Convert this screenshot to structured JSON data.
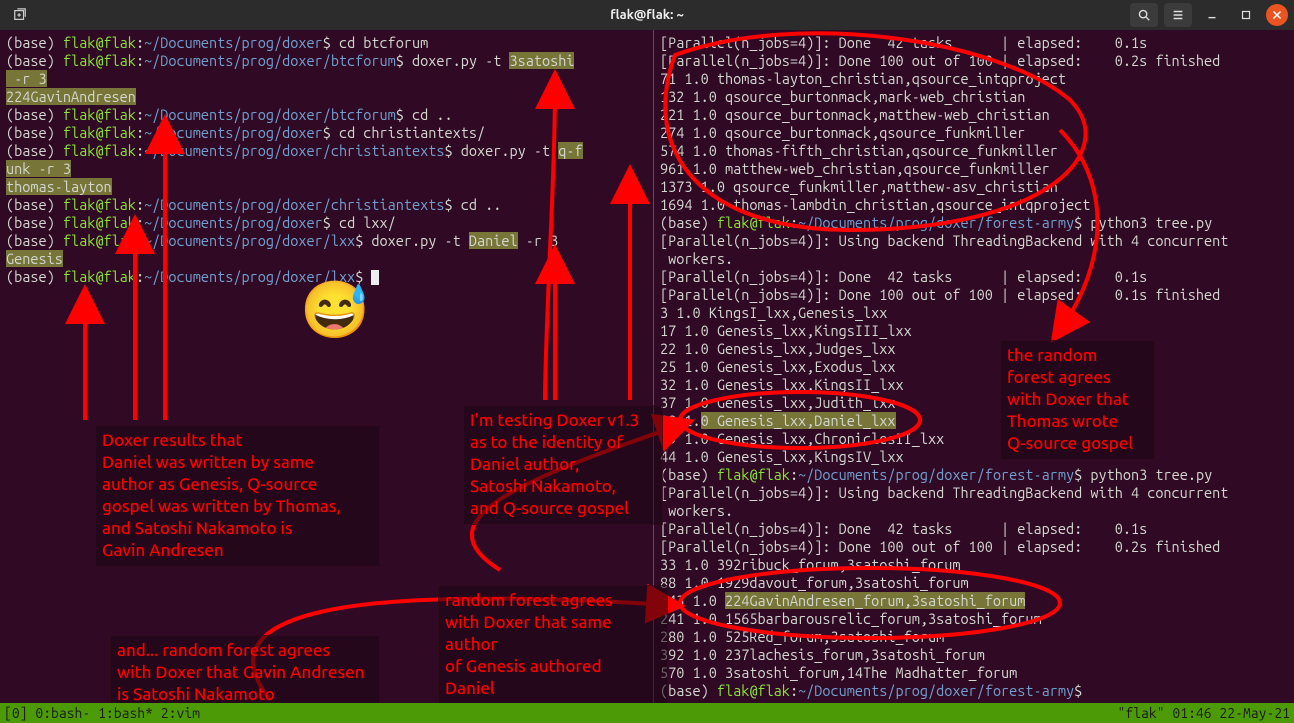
{
  "titlebar": {
    "title": "flak@flak: ~"
  },
  "statusbar": {
    "left": "[0] 0:bash- 1:bash* 2:vim",
    "right": "\"flak\" 01:46 22-May-21"
  },
  "left_lines": [
    {
      "segs": [
        {
          "t": "(base) ",
          "c": "white"
        },
        {
          "t": "flak@flak",
          "c": "green"
        },
        {
          "t": ":",
          "c": "white"
        },
        {
          "t": "~/Documents/prog/doxer",
          "c": "blue"
        },
        {
          "t": "$ cd btcforum",
          "c": "white"
        }
      ]
    },
    {
      "segs": [
        {
          "t": "(base) ",
          "c": "white"
        },
        {
          "t": "flak@flak",
          "c": "green"
        },
        {
          "t": ":",
          "c": "white"
        },
        {
          "t": "~/Documents/prog/doxer/btcforum",
          "c": "blue"
        },
        {
          "t": "$ doxer.py -t ",
          "c": "white"
        },
        {
          "t": "3satoshi",
          "c": "hi"
        }
      ]
    },
    {
      "segs": [
        {
          "t": " -r 3",
          "c": "hi"
        }
      ]
    },
    {
      "segs": [
        {
          "t": "224GavinAndresen",
          "c": "hi"
        }
      ]
    },
    {
      "segs": [
        {
          "t": "(base) ",
          "c": "white"
        },
        {
          "t": "flak@flak",
          "c": "green"
        },
        {
          "t": ":",
          "c": "white"
        },
        {
          "t": "~/Documents/prog/doxer/btcforum",
          "c": "blue"
        },
        {
          "t": "$ cd ..",
          "c": "white"
        }
      ]
    },
    {
      "segs": [
        {
          "t": "(base) ",
          "c": "white"
        },
        {
          "t": "flak@flak",
          "c": "green"
        },
        {
          "t": ":",
          "c": "white"
        },
        {
          "t": "~/Documents/prog/doxer",
          "c": "blue"
        },
        {
          "t": "$ cd christiantexts/",
          "c": "white"
        }
      ]
    },
    {
      "segs": [
        {
          "t": "(base) ",
          "c": "white"
        },
        {
          "t": "flak@flak",
          "c": "green"
        },
        {
          "t": ":",
          "c": "white"
        },
        {
          "t": "~/Documents/prog/doxer/christiantexts",
          "c": "blue"
        },
        {
          "t": "$ doxer.py -t ",
          "c": "white"
        },
        {
          "t": "q-f",
          "c": "hi"
        }
      ]
    },
    {
      "segs": [
        {
          "t": "unk -r 3",
          "c": "hi"
        }
      ]
    },
    {
      "segs": [
        {
          "t": "thomas-layton",
          "c": "hi"
        }
      ]
    },
    {
      "segs": [
        {
          "t": "(base) ",
          "c": "white"
        },
        {
          "t": "flak@flak",
          "c": "green"
        },
        {
          "t": ":",
          "c": "white"
        },
        {
          "t": "~/Documents/prog/doxer/christiantexts",
          "c": "blue"
        },
        {
          "t": "$ cd ..",
          "c": "white"
        }
      ]
    },
    {
      "segs": [
        {
          "t": "(base) ",
          "c": "white"
        },
        {
          "t": "flak@flak",
          "c": "green"
        },
        {
          "t": ":",
          "c": "white"
        },
        {
          "t": "~/Documents/prog/doxer",
          "c": "blue"
        },
        {
          "t": "$ cd lxx/",
          "c": "white"
        }
      ]
    },
    {
      "segs": [
        {
          "t": "(base) ",
          "c": "white"
        },
        {
          "t": "flak@flak",
          "c": "green"
        },
        {
          "t": ":",
          "c": "white"
        },
        {
          "t": "~/Documents/prog/doxer/lxx",
          "c": "blue"
        },
        {
          "t": "$ doxer.py -t ",
          "c": "white"
        },
        {
          "t": "Daniel",
          "c": "hi"
        },
        {
          "t": " -r 3",
          "c": "white"
        }
      ]
    },
    {
      "segs": [
        {
          "t": "Genesis",
          "c": "hi"
        }
      ]
    },
    {
      "segs": [
        {
          "t": "(base) ",
          "c": "white"
        },
        {
          "t": "flak@flak",
          "c": "green"
        },
        {
          "t": ":",
          "c": "white"
        },
        {
          "t": "~/Documents/prog/doxer/lxx",
          "c": "blue"
        },
        {
          "t": "$ ",
          "c": "white"
        },
        {
          "t": " ",
          "c": "cursor"
        }
      ]
    }
  ],
  "right_lines": [
    {
      "segs": [
        {
          "t": "[Parallel(n_jobs=4)]: Done  42 tasks      | elapsed:    0.1s",
          "c": "white"
        }
      ]
    },
    {
      "segs": [
        {
          "t": "[Parallel(n_jobs=4)]: Done 100 out of 100 | elapsed:    0.2s finished",
          "c": "white"
        }
      ]
    },
    {
      "segs": [
        {
          "t": "71 1.0 thomas-layton_christian,qsource_intqproject",
          "c": "white"
        }
      ]
    },
    {
      "segs": [
        {
          "t": "132 1.0 qsource_burtonmack,mark-web_christian",
          "c": "white"
        }
      ]
    },
    {
      "segs": [
        {
          "t": "221 1.0 qsource_burtonmack,matthew-web_christian",
          "c": "white"
        }
      ]
    },
    {
      "segs": [
        {
          "t": "274 1.0 qsource_burtonmack,qsource_funkmiller",
          "c": "white"
        }
      ]
    },
    {
      "segs": [
        {
          "t": "574 1.0 thomas-fifth_christian,qsource_funkmiller",
          "c": "white"
        }
      ]
    },
    {
      "segs": [
        {
          "t": "961 1.0 matthew-web_christian,qsource_funkmiller",
          "c": "white"
        }
      ]
    },
    {
      "segs": [
        {
          "t": "1373 1.0 qsource_funkmiller,matthew-asv_christian",
          "c": "white"
        }
      ]
    },
    {
      "segs": [
        {
          "t": "1694 1.0 thomas-lambdin_christian,qsource_intqproject",
          "c": "white"
        }
      ]
    },
    {
      "segs": [
        {
          "t": "(base) ",
          "c": "white"
        },
        {
          "t": "flak@flak",
          "c": "green"
        },
        {
          "t": ":",
          "c": "white"
        },
        {
          "t": "~/Documents/prog/doxer/forest-army",
          "c": "blue"
        },
        {
          "t": "$ python3 tree.py",
          "c": "white"
        }
      ]
    },
    {
      "segs": [
        {
          "t": "[Parallel(n_jobs=4)]: Using backend ThreadingBackend with 4 concurrent",
          "c": "white"
        }
      ]
    },
    {
      "segs": [
        {
          "t": " workers.",
          "c": "white"
        }
      ]
    },
    {
      "segs": [
        {
          "t": "[Parallel(n_jobs=4)]: Done  42 tasks      | elapsed:    0.1s",
          "c": "white"
        }
      ]
    },
    {
      "segs": [
        {
          "t": "[Parallel(n_jobs=4)]: Done 100 out of 100 | elapsed:    0.1s finished",
          "c": "white"
        }
      ]
    },
    {
      "segs": [
        {
          "t": "3 1.0 KingsI_lxx,Genesis_lxx",
          "c": "white"
        }
      ]
    },
    {
      "segs": [
        {
          "t": "17 1.0 Genesis_lxx,KingsIII_lxx",
          "c": "white"
        }
      ]
    },
    {
      "segs": [
        {
          "t": "22 1.0 Genesis_lxx,Judges_lxx",
          "c": "white"
        }
      ]
    },
    {
      "segs": [
        {
          "t": "25 1.0 Genesis_lxx,Exodus_lxx",
          "c": "white"
        }
      ]
    },
    {
      "segs": [
        {
          "t": "32 1.0 Genesis_lxx,KingsII_lxx",
          "c": "white"
        }
      ]
    },
    {
      "segs": [
        {
          "t": "37 1.0 Genesis_lxx,Judith_lxx",
          "c": "white"
        }
      ]
    },
    {
      "segs": [
        {
          "t": "38 1.",
          "c": "white"
        },
        {
          "t": "0 Genesis_lxx,Daniel_lxx",
          "c": "hi"
        }
      ]
    },
    {
      "segs": [
        {
          "t": "39 1.0 Genesis_lxx,ChroniclesII_lxx",
          "c": "white"
        }
      ]
    },
    {
      "segs": [
        {
          "t": "44 1.0 Genesis_lxx,KingsIV_lxx",
          "c": "white"
        }
      ]
    },
    {
      "segs": [
        {
          "t": "(base) ",
          "c": "white"
        },
        {
          "t": "flak@flak",
          "c": "green"
        },
        {
          "t": ":",
          "c": "white"
        },
        {
          "t": "~/Documents/prog/doxer/forest-army",
          "c": "blue"
        },
        {
          "t": "$ python3 tree.py",
          "c": "white"
        }
      ]
    },
    {
      "segs": [
        {
          "t": "[Parallel(n_jobs=4)]: Using backend ThreadingBackend with 4 concurrent",
          "c": "white"
        }
      ]
    },
    {
      "segs": [
        {
          "t": " workers.",
          "c": "white"
        }
      ]
    },
    {
      "segs": [
        {
          "t": "[Parallel(n_jobs=4)]: Done  42 tasks      | elapsed:    0.1s",
          "c": "white"
        }
      ]
    },
    {
      "segs": [
        {
          "t": "[Parallel(n_jobs=4)]: Done 100 out of 100 | elapsed:    0.2s finished",
          "c": "white"
        }
      ]
    },
    {
      "segs": [
        {
          "t": "33 1.0 392ribuck_forum,3satoshi_forum",
          "c": "white"
        }
      ]
    },
    {
      "segs": [
        {
          "t": "88 1.0 1929davout_forum,3satoshi_forum",
          "c": "white"
        }
      ]
    },
    {
      "segs": [
        {
          "t": "143 1.0 ",
          "c": "white"
        },
        {
          "t": "224GavinAndresen_forum,3satoshi_forum",
          "c": "hi"
        }
      ]
    },
    {
      "segs": [
        {
          "t": "241 1.0 1565barbarousrelic_forum,3satoshi_forum",
          "c": "white"
        }
      ]
    },
    {
      "segs": [
        {
          "t": "280 1.0 525Red_forum,3satoshi_forum",
          "c": "white"
        }
      ]
    },
    {
      "segs": [
        {
          "t": "392 1.0 237lachesis_forum,3satoshi_forum",
          "c": "white"
        }
      ]
    },
    {
      "segs": [
        {
          "t": "570 1.0 3satoshi_forum,14The Madhatter_forum",
          "c": "white"
        }
      ]
    },
    {
      "segs": [
        {
          "t": "(base) ",
          "c": "white"
        },
        {
          "t": "flak@flak",
          "c": "green"
        },
        {
          "t": ":",
          "c": "white"
        },
        {
          "t": "~/Documents/prog/doxer/forest-army",
          "c": "blue"
        },
        {
          "t": "$",
          "c": "white"
        }
      ]
    }
  ],
  "annos": {
    "a1": "Doxer results that\nDaniel was written by same\nauthor as Genesis, Q-source\ngospel was written by Thomas,\nand Satoshi Nakamoto is\nGavin Andresen",
    "a2": "I'm testing Doxer v1.3\nas to the identity of\nDaniel author,\nSatoshi Nakamoto,\nand Q-source  gospel",
    "a3": "the random\nforest agrees\nwith Doxer that\nThomas wrote\nQ-source gospel",
    "a4": "random forest agrees\nwith Doxer that same author\nof Genesis authored\nDaniel",
    "a5": "and... random forest agrees\nwith Doxer that Gavin Andresen\nis Satoshi Nakamoto"
  }
}
